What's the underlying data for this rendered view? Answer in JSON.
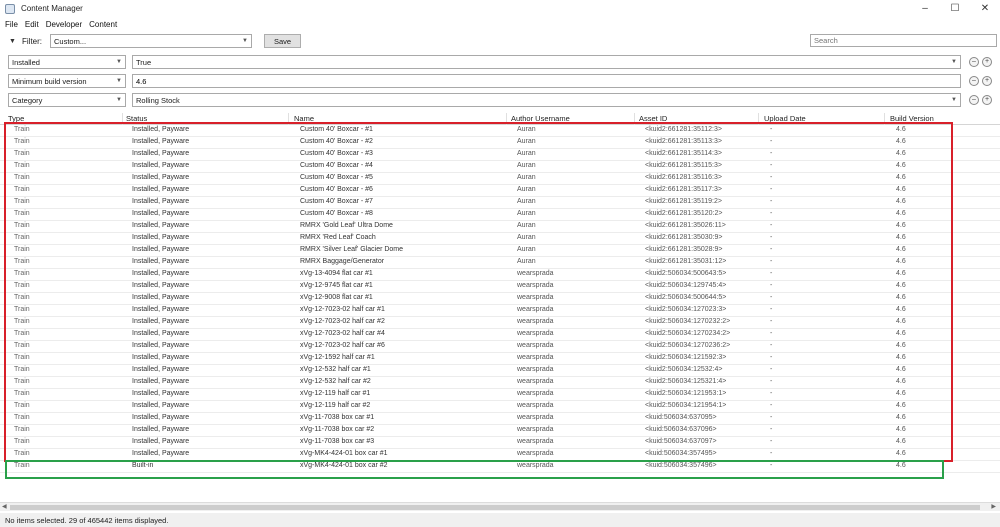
{
  "window": {
    "title": "Content Manager",
    "controls": [
      "–",
      "☐",
      "✕"
    ]
  },
  "menu": [
    "File",
    "Edit",
    "Developer",
    "Content"
  ],
  "filter": {
    "label": "Filter:",
    "preset": "Custom...",
    "save_label": "Save",
    "search_placeholder": "Search"
  },
  "criteria": [
    {
      "field": "Installed",
      "value": "True"
    },
    {
      "field": "Minimum build version",
      "value": "4.6"
    },
    {
      "field": "Category",
      "value": "Rolling Stock"
    }
  ],
  "columns": [
    "Type",
    "Status",
    "Name",
    "Author Username",
    "Asset ID",
    "Upload Date",
    "Build Version"
  ],
  "rows": [
    {
      "type": "Train",
      "status": "Installed, Payware",
      "name": "Custom 40' Boxcar - #1",
      "author": "Auran",
      "asset": "<kuid2:661281:35112:3>",
      "upload": "-",
      "build": "4.6"
    },
    {
      "type": "Train",
      "status": "Installed, Payware",
      "name": "Custom 40' Boxcar - #2",
      "author": "Auran",
      "asset": "<kuid2:661281:35113:3>",
      "upload": "-",
      "build": "4.6"
    },
    {
      "type": "Train",
      "status": "Installed, Payware",
      "name": "Custom 40' Boxcar - #3",
      "author": "Auran",
      "asset": "<kuid2:661281:35114:3>",
      "upload": "-",
      "build": "4.6"
    },
    {
      "type": "Train",
      "status": "Installed, Payware",
      "name": "Custom 40' Boxcar - #4",
      "author": "Auran",
      "asset": "<kuid2:661281:35115:3>",
      "upload": "-",
      "build": "4.6"
    },
    {
      "type": "Train",
      "status": "Installed, Payware",
      "name": "Custom 40' Boxcar - #5",
      "author": "Auran",
      "asset": "<kuid2:661281:35116:3>",
      "upload": "-",
      "build": "4.6"
    },
    {
      "type": "Train",
      "status": "Installed, Payware",
      "name": "Custom 40' Boxcar - #6",
      "author": "Auran",
      "asset": "<kuid2:661281:35117:3>",
      "upload": "-",
      "build": "4.6"
    },
    {
      "type": "Train",
      "status": "Installed, Payware",
      "name": "Custom 40' Boxcar - #7",
      "author": "Auran",
      "asset": "<kuid2:661281:35119:2>",
      "upload": "-",
      "build": "4.6"
    },
    {
      "type": "Train",
      "status": "Installed, Payware",
      "name": "Custom 40' Boxcar - #8",
      "author": "Auran",
      "asset": "<kuid2:661281:35120:2>",
      "upload": "-",
      "build": "4.6"
    },
    {
      "type": "Train",
      "status": "Installed, Payware",
      "name": "RMRX 'Gold Leaf' Ultra Dome",
      "author": "Auran",
      "asset": "<kuid2:661281:35026:11>",
      "upload": "-",
      "build": "4.6"
    },
    {
      "type": "Train",
      "status": "Installed, Payware",
      "name": "RMRX 'Red Leaf' Coach",
      "author": "Auran",
      "asset": "<kuid2:661281:35030:9>",
      "upload": "-",
      "build": "4.6"
    },
    {
      "type": "Train",
      "status": "Installed, Payware",
      "name": "RMRX 'Silver Leaf' Glacier Dome",
      "author": "Auran",
      "asset": "<kuid2:661281:35028:9>",
      "upload": "-",
      "build": "4.6"
    },
    {
      "type": "Train",
      "status": "Installed, Payware",
      "name": "RMRX Baggage/Generator",
      "author": "Auran",
      "asset": "<kuid2:661281:35031:12>",
      "upload": "-",
      "build": "4.6"
    },
    {
      "type": "Train",
      "status": "Installed, Payware",
      "name": "xVg-13-4094 flat car #1",
      "author": "wearsprada",
      "asset": "<kuid2:506034:500643:5>",
      "upload": "-",
      "build": "4.6"
    },
    {
      "type": "Train",
      "status": "Installed, Payware",
      "name": "xVg-12-9745 flat car #1",
      "author": "wearsprada",
      "asset": "<kuid2:506034:129745:4>",
      "upload": "-",
      "build": "4.6"
    },
    {
      "type": "Train",
      "status": "Installed, Payware",
      "name": "xVg-12-9008 flat car #1",
      "author": "wearsprada",
      "asset": "<kuid2:506034:500644:5>",
      "upload": "-",
      "build": "4.6"
    },
    {
      "type": "Train",
      "status": "Installed, Payware",
      "name": "xVg-12-7023-02 half car #1",
      "author": "wearsprada",
      "asset": "<kuid2:506034:127023:3>",
      "upload": "-",
      "build": "4.6"
    },
    {
      "type": "Train",
      "status": "Installed, Payware",
      "name": "xVg-12-7023-02 half car #2",
      "author": "wearsprada",
      "asset": "<kuid2:506034:1270232:2>",
      "upload": "-",
      "build": "4.6"
    },
    {
      "type": "Train",
      "status": "Installed, Payware",
      "name": "xVg-12-7023-02 half car #4",
      "author": "wearsprada",
      "asset": "<kuid2:506034:1270234:2>",
      "upload": "-",
      "build": "4.6"
    },
    {
      "type": "Train",
      "status": "Installed, Payware",
      "name": "xVg-12-7023-02 half car #6",
      "author": "wearsprada",
      "asset": "<kuid2:506034:1270236:2>",
      "upload": "-",
      "build": "4.6"
    },
    {
      "type": "Train",
      "status": "Installed, Payware",
      "name": "xVg-12-1592 half car #1",
      "author": "wearsprada",
      "asset": "<kuid2:506034:121592:3>",
      "upload": "-",
      "build": "4.6"
    },
    {
      "type": "Train",
      "status": "Installed, Payware",
      "name": "xVg-12-532 half car #1",
      "author": "wearsprada",
      "asset": "<kuid2:506034:12532:4>",
      "upload": "-",
      "build": "4.6"
    },
    {
      "type": "Train",
      "status": "Installed, Payware",
      "name": "xVg-12-532 half car #2",
      "author": "wearsprada",
      "asset": "<kuid2:506034:125321:4>",
      "upload": "-",
      "build": "4.6"
    },
    {
      "type": "Train",
      "status": "Installed, Payware",
      "name": "xVg-12-119 half car #1",
      "author": "wearsprada",
      "asset": "<kuid2:506034:121953:1>",
      "upload": "-",
      "build": "4.6"
    },
    {
      "type": "Train",
      "status": "Installed, Payware",
      "name": "xVg-12-119 half car #2",
      "author": "wearsprada",
      "asset": "<kuid2:506034:121954:1>",
      "upload": "-",
      "build": "4.6"
    },
    {
      "type": "Train",
      "status": "Installed, Payware",
      "name": "xVg-11-7038 box car #1",
      "author": "wearsprada",
      "asset": "<kuid:506034:637095>",
      "upload": "-",
      "build": "4.6"
    },
    {
      "type": "Train",
      "status": "Installed, Payware",
      "name": "xVg-11-7038 box car #2",
      "author": "wearsprada",
      "asset": "<kuid:506034:637096>",
      "upload": "-",
      "build": "4.6"
    },
    {
      "type": "Train",
      "status": "Installed, Payware",
      "name": "xVg-11-7038 box car #3",
      "author": "wearsprada",
      "asset": "<kuid:506034:637097>",
      "upload": "-",
      "build": "4.6"
    },
    {
      "type": "Train",
      "status": "Installed, Payware",
      "name": "xVg-MK4-424-01 box car #1",
      "author": "wearsprada",
      "asset": "<kuid:506034:357495>",
      "upload": "-",
      "build": "4.6"
    },
    {
      "type": "Train",
      "status": "Built-in",
      "name": "xVg-MK4-424-01 box car #2",
      "author": "wearsprada",
      "asset": "<kuid:506034:357496>",
      "upload": "-",
      "build": "4.6"
    }
  ],
  "highlight_colors": {
    "red": "#d8202a",
    "green": "#2aa04a"
  },
  "scroll": {
    "left_arrow": "◀",
    "right_arrow": "▶"
  },
  "status_bar": "No items selected. 29 of 465442 items displayed."
}
